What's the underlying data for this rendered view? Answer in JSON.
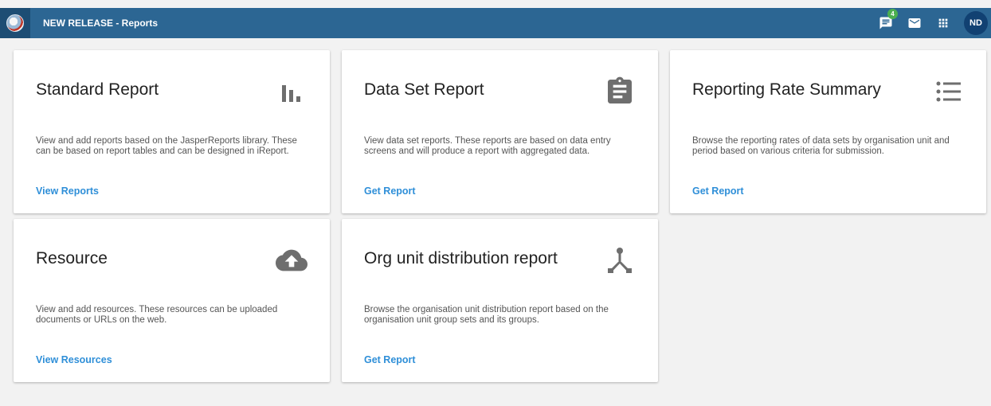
{
  "header": {
    "app_title": "NEW RELEASE - Reports",
    "messages_badge": "4",
    "user_initials": "ND",
    "brand_color": "#2c6693"
  },
  "icons": [
    "logo-icon",
    "messages-icon",
    "mail-icon",
    "apps-grid-icon",
    "bar-chart-icon",
    "clipboard-icon",
    "list-icon",
    "cloud-upload-icon",
    "org-tree-icon"
  ],
  "cards": [
    {
      "title": "Standard Report",
      "description": "View and add reports based on the JasperReports library. These can be based on report tables and can be designed in iReport.",
      "link": "View Reports",
      "icon": "bar-chart-icon"
    },
    {
      "title": "Data Set Report",
      "description": "View data set reports. These reports are based on data entry screens and will produce a report with aggregated data.",
      "link": "Get Report",
      "icon": "clipboard-icon"
    },
    {
      "title": "Reporting Rate Summary",
      "description": "Browse the reporting rates of data sets by organisation unit and period based on various criteria for submission.",
      "link": "Get Report",
      "icon": "list-icon"
    },
    {
      "title": "Resource",
      "description": "View and add resources. These resources can be uploaded documents or URLs on the web.",
      "link": "View Resources",
      "icon": "cloud-upload-icon"
    },
    {
      "title": "Org unit distribution report",
      "description": "Browse the organisation unit distribution report based on the organisation unit group sets and its groups.",
      "link": "Get Report",
      "icon": "org-tree-icon"
    }
  ],
  "colors": {
    "link": "#2f8fd8",
    "icon": "#6e6e6e",
    "background": "#f2f2f2"
  }
}
